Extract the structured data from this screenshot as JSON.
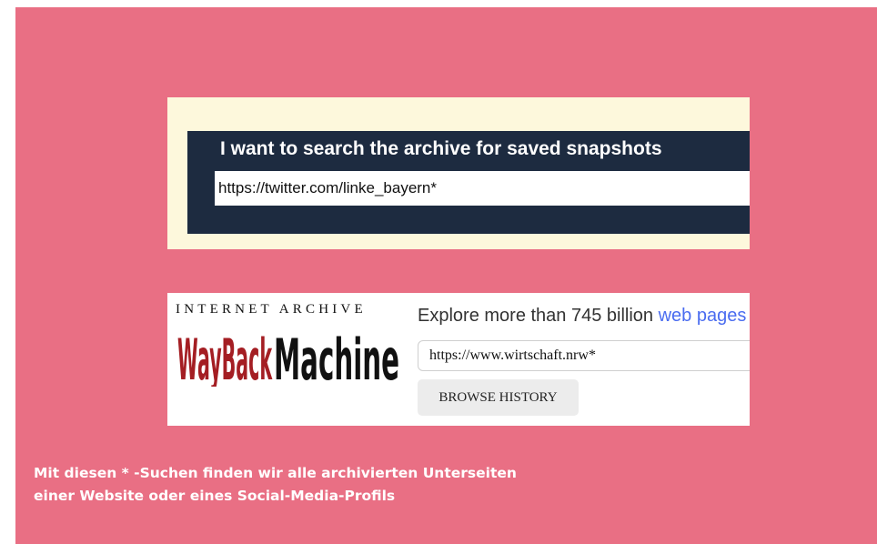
{
  "colors": {
    "background": "#e96f84",
    "snapshot_panel": "#fdf8dc",
    "snapshot_bar": "#1d2b40",
    "link": "#4a6cf0",
    "logo_red": "#a41e23"
  },
  "snapshot_search": {
    "heading": "I want to search the archive for saved snapshots",
    "input_value": "https://twitter.com/linke_bayern*"
  },
  "wayback": {
    "brand_top": "INTERNET ARCHIVE",
    "brand_logo": "WayBackMachine",
    "explore_text": "Explore more than 745 billion ",
    "explore_link": "web pages",
    "input_value": "https://www.wirtschaft.nrw*",
    "browse_button": "BROWSE HISTORY"
  },
  "caption": {
    "line1": "Mit diesen * -Suchen finden wir alle archivierten Unterseiten",
    "line2": "einer Website oder eines Social-Media-Profils"
  }
}
